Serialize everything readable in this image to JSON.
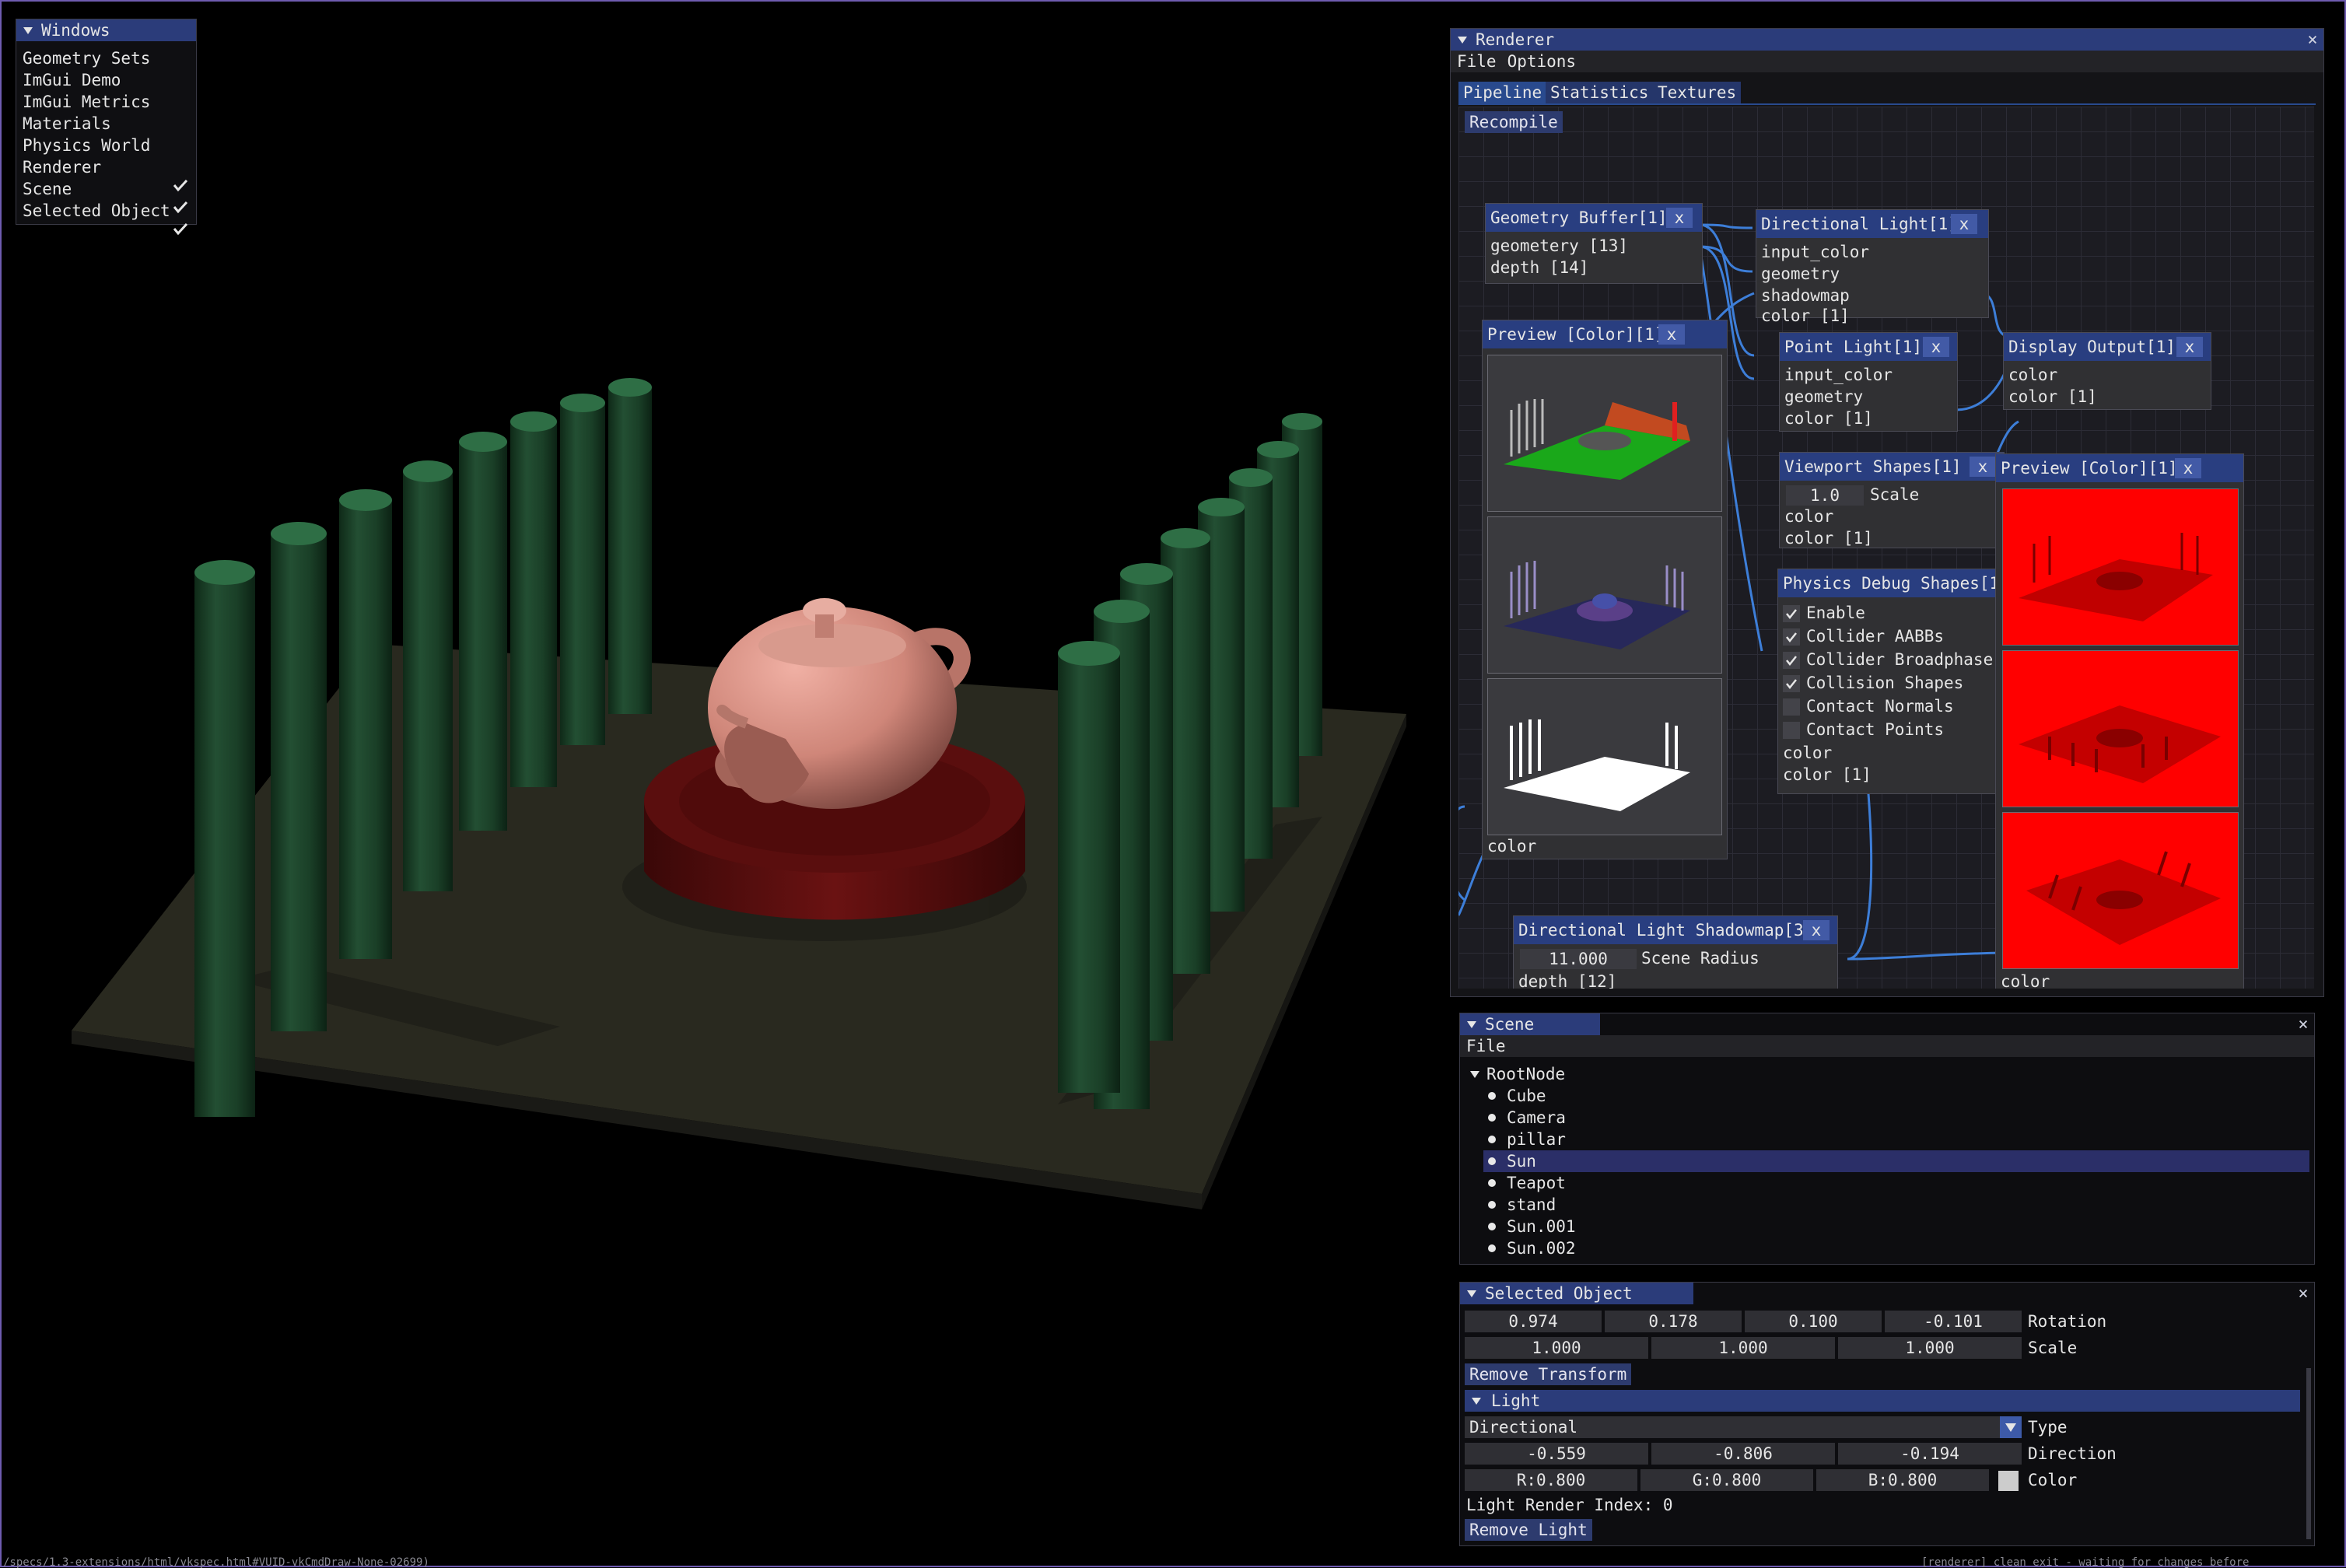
{
  "colors": {
    "title_active": "#2b3c7a",
    "node_header": "#293e80",
    "button": "#2d3b6e",
    "wire": "#3d7ed8",
    "pillar": "#1e4a2e",
    "teapot": "#d08a80",
    "stand": "#6a1414",
    "floor": "#2a2a24",
    "preview_red": "#ff0000"
  },
  "windows_menu": {
    "title": "Windows",
    "items": [
      {
        "label": "Geometry Sets",
        "checked": false
      },
      {
        "label": "ImGui Demo",
        "checked": false
      },
      {
        "label": "ImGui Metrics",
        "checked": false
      },
      {
        "label": "Materials",
        "checked": false
      },
      {
        "label": "Physics World",
        "checked": false
      },
      {
        "label": "Renderer",
        "checked": true
      },
      {
        "label": "Scene",
        "checked": true
      },
      {
        "label": "Selected Object",
        "checked": true
      }
    ]
  },
  "renderer": {
    "title": "Renderer",
    "close": "×",
    "menu": [
      "File",
      "Options"
    ],
    "tabs": [
      "Pipeline",
      "Statistics",
      "Textures"
    ],
    "recompile_label": "Recompile",
    "nodes": {
      "geometry_buffer": {
        "title": "Geometry Buffer[1]",
        "close": "x",
        "pins": [
          "geometery [13]",
          "depth [14]"
        ]
      },
      "directional_light": {
        "title": "Directional Light[1]",
        "close": "x",
        "pins": [
          "input_color",
          "geometry",
          "shadowmap",
          "color [1]"
        ]
      },
      "preview_color_left": {
        "title": "Preview [Color][1]",
        "close": "x",
        "pins": [
          "color"
        ]
      },
      "point_light": {
        "title": "Point Light[1]",
        "close": "x",
        "pins": [
          "input_color",
          "geometry",
          "color [1]"
        ]
      },
      "display_output": {
        "title": "Display Output[1]",
        "close": "x",
        "pins": [
          "color",
          "color [1]"
        ]
      },
      "viewport_shapes": {
        "title": "Viewport Shapes[1]",
        "close": "x",
        "scale_value": "1.0",
        "scale_label": "Scale",
        "pins": [
          "color",
          "color [1]"
        ]
      },
      "physics_debug": {
        "title": "Physics Debug Shapes[1",
        "checks": [
          {
            "label": "Enable",
            "checked": true
          },
          {
            "label": "Collider AABBs",
            "checked": true
          },
          {
            "label": "Collider Broadphase",
            "checked": true
          },
          {
            "label": "Collision Shapes",
            "checked": true
          },
          {
            "label": "Contact Normals",
            "checked": false
          },
          {
            "label": "Contact Points",
            "checked": false
          }
        ],
        "pins": [
          "color",
          "color [1]"
        ]
      },
      "preview_color_right": {
        "title": "Preview [Color][1]",
        "close": "x",
        "pins": [
          "color"
        ]
      },
      "shadowmap": {
        "title": "Directional Light Shadowmap[3]",
        "close": "x",
        "radius_value": "11.000",
        "radius_label": "Scene Radius",
        "pins": [
          "depth [12]"
        ]
      }
    }
  },
  "scene": {
    "title": "Scene",
    "close": "×",
    "menu": [
      "File"
    ],
    "root": "RootNode",
    "items": [
      {
        "label": "Cube",
        "selected": false
      },
      {
        "label": "Camera",
        "selected": false
      },
      {
        "label": "pillar",
        "selected": false
      },
      {
        "label": "Sun",
        "selected": true
      },
      {
        "label": "Teapot",
        "selected": false
      },
      {
        "label": "stand",
        "selected": false
      },
      {
        "label": "Sun.001",
        "selected": false
      },
      {
        "label": "Sun.002",
        "selected": false
      }
    ]
  },
  "selected_object": {
    "title": "Selected Object",
    "close": "×",
    "rotation": [
      "0.974",
      "0.178",
      "0.100",
      "-0.101"
    ],
    "rotation_label": "Rotation",
    "scale": [
      "1.000",
      "1.000",
      "1.000"
    ],
    "scale_label": "Scale",
    "remove_transform_label": "Remove Transform",
    "light_header": "Light",
    "type_value": "Directional",
    "type_label": "Type",
    "direction": [
      "-0.559",
      "-0.806",
      "-0.194"
    ],
    "direction_label": "Direction",
    "color": [
      "R:0.800",
      "G:0.800",
      "B:0.800"
    ],
    "color_label": "Color",
    "color_swatch": "#cccccc",
    "render_index": "Light Render Index: 0",
    "remove_light_label": "Remove Light"
  },
  "status": {
    "left": "/specs/1.3-extensions/html/vkspec.html#VUID-vkCmdDraw-None-02699)",
    "right": "[renderer] clean exit - waiting for changes before"
  }
}
